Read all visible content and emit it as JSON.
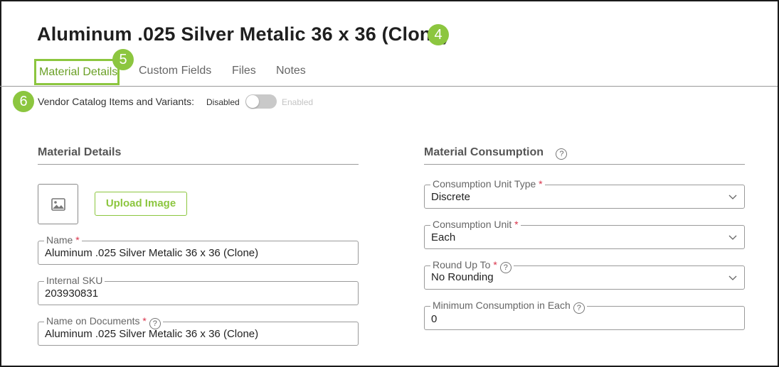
{
  "title": "Aluminum .025 Silver Metalic 36 x 36 (Clone)",
  "badges": {
    "title": "4",
    "tab": "5",
    "vendor": "6"
  },
  "tabs": [
    {
      "label": "Material Details",
      "active": true
    },
    {
      "label": "Custom Fields"
    },
    {
      "label": "Files"
    },
    {
      "label": "Notes"
    }
  ],
  "vendor_catalog": {
    "label": "Vendor Catalog Items and Variants:",
    "off_label": "Disabled",
    "on_label": "Enabled",
    "enabled": false
  },
  "material_details": {
    "heading": "Material Details",
    "image_icon": "image-icon",
    "upload_label": "Upload Image",
    "name": {
      "label": "Name",
      "required": "*",
      "value": "Aluminum .025 Silver Metalic 36 x 36 (Clone)"
    },
    "internal_sku": {
      "label": "Internal SKU",
      "value": "203930831"
    },
    "name_on_documents": {
      "label": "Name on Documents",
      "required": "*",
      "value": "Aluminum .025 Silver Metalic 36 x 36 (Clone)"
    }
  },
  "material_consumption": {
    "heading": "Material Consumption",
    "unit_type": {
      "label": "Consumption Unit Type",
      "required": "*",
      "value": "Discrete"
    },
    "unit": {
      "label": "Consumption Unit",
      "required": "*",
      "value": "Each"
    },
    "round_up": {
      "label": "Round Up To",
      "required": "*",
      "value": "No Rounding"
    },
    "minimum": {
      "label": "Minimum Consumption in Each",
      "value": "0"
    }
  },
  "help_glyph": "?",
  "colors": {
    "accent": "#8cc63f",
    "required": "#d9334a",
    "border": "#9a9a9a"
  }
}
